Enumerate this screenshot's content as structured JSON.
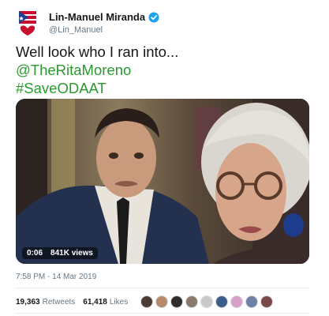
{
  "author": {
    "display_name": "Lin-Manuel Miranda",
    "handle": "@Lin_Manuel",
    "avatar_icon": "puerto-rico-flag-heart-icon",
    "verified_icon": "verified-badge-icon"
  },
  "tweet": {
    "lines": [
      "Well look who I ran into...",
      "@TheRitaMoreno",
      "#SaveODAAT"
    ],
    "link_color": "#2a9a2e"
  },
  "video": {
    "duration": "0:06",
    "views": "841K views"
  },
  "meta": {
    "timestamp": "7:58 PM - 14 Mar 2019"
  },
  "stats": {
    "retweets_count": "19,363",
    "retweets_label": "Retweets",
    "likes_count": "61,418",
    "likes_label": "Likes"
  },
  "liker_avatars": [
    "#4a3b33",
    "#b58a6b",
    "#2d2d2d",
    "#8a7a6a",
    "#c9c9c9",
    "#3b5f8a",
    "#d8a0c8",
    "#6e7fa8",
    "#7a4a4a"
  ]
}
